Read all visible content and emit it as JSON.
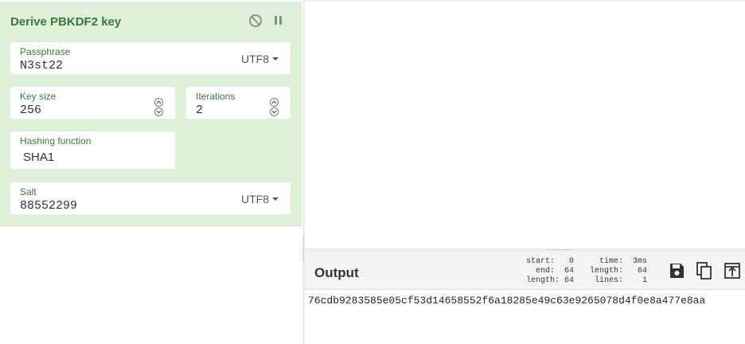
{
  "operation": {
    "title": "Derive PBKDF2 key",
    "disable_icon": "disable-icon",
    "pause_icon": "pause-icon",
    "passphrase": {
      "label": "Passphrase",
      "value": "N3st22",
      "encoding": "UTF8"
    },
    "key_size": {
      "label": "Key size",
      "value": "256"
    },
    "iterations": {
      "label": "Iterations",
      "value": "2"
    },
    "hashing_function": {
      "label": "Hashing function",
      "value": "SHA1"
    },
    "salt": {
      "label": "Salt",
      "value": "88552299",
      "encoding": "UTF8"
    }
  },
  "output": {
    "title": "Output",
    "stats": {
      "start_label": "start:",
      "start": "0",
      "end_label": "end:",
      "end": "64",
      "length_label": "length:",
      "length": "64",
      "time_label": "time:",
      "time": "3ms",
      "out_length_label": "length:",
      "out_length": "64",
      "lines_label": "lines:",
      "lines": "1"
    },
    "value": "76cdb9283585e05cf53d14658552f6a18285e49c63e9265078d4f0e8a477e8aa"
  },
  "colors": {
    "card_bg": "#dff0d8",
    "accent_green": "#3c763d",
    "output_header_bg": "#f4f4f4"
  }
}
